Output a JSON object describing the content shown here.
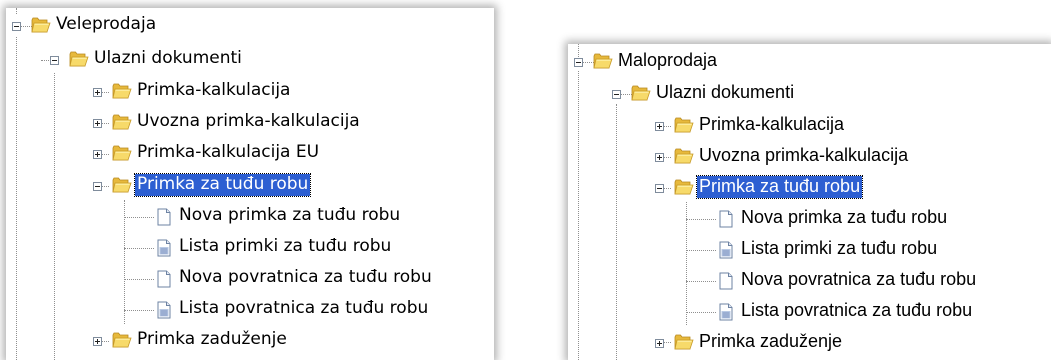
{
  "colors": {
    "selection": "#2d5fd2",
    "folder": "#f2d05a",
    "tree_lines": "#8f8f8f"
  },
  "icons": {
    "folder": "folder-icon",
    "new_document": "document-icon",
    "list_document": "list-document-icon"
  },
  "left_tree": {
    "root": {
      "label": "Veleprodaja",
      "state": "expanded"
    },
    "group": {
      "label": "Ulazni dokumenti",
      "state": "expanded"
    },
    "items": [
      {
        "label": "Primka-kalkulacija",
        "state": "collapsed"
      },
      {
        "label": "Uvozna primka-kalkulacija",
        "state": "collapsed"
      },
      {
        "label": "Primka-kalkulacija EU",
        "state": "collapsed"
      },
      {
        "label": "Primka za tuđu robu",
        "state": "expanded",
        "selected": true
      }
    ],
    "children": [
      {
        "label": "Nova primka za tuđu robu",
        "icon": "document-icon"
      },
      {
        "label": "Lista primki za tuđu robu",
        "icon": "list-document-icon"
      },
      {
        "label": "Nova povratnica za tuđu robu",
        "icon": "document-icon"
      },
      {
        "label": "Lista povratnica za tuđu robu",
        "icon": "list-document-icon"
      }
    ],
    "last": {
      "label": "Primka zaduženje",
      "state": "collapsed"
    }
  },
  "right_tree": {
    "root": {
      "label": "Maloprodaja",
      "state": "expanded"
    },
    "group": {
      "label": "Ulazni dokumenti",
      "state": "expanded"
    },
    "items": [
      {
        "label": "Primka-kalkulacija",
        "state": "collapsed"
      },
      {
        "label": "Uvozna primka-kalkulacija",
        "state": "collapsed"
      },
      {
        "label": "Primka za tuđu robu",
        "state": "expanded",
        "selected": true
      }
    ],
    "children": [
      {
        "label": "Nova primka za tuđu robu",
        "icon": "document-icon"
      },
      {
        "label": "Lista primki za tuđu robu",
        "icon": "list-document-icon"
      },
      {
        "label": "Nova povratnica za tuđu robu",
        "icon": "document-icon"
      },
      {
        "label": "Lista povratnica za tuđu robu",
        "icon": "list-document-icon"
      }
    ],
    "last": {
      "label": "Primka zaduženje",
      "state": "collapsed"
    }
  }
}
